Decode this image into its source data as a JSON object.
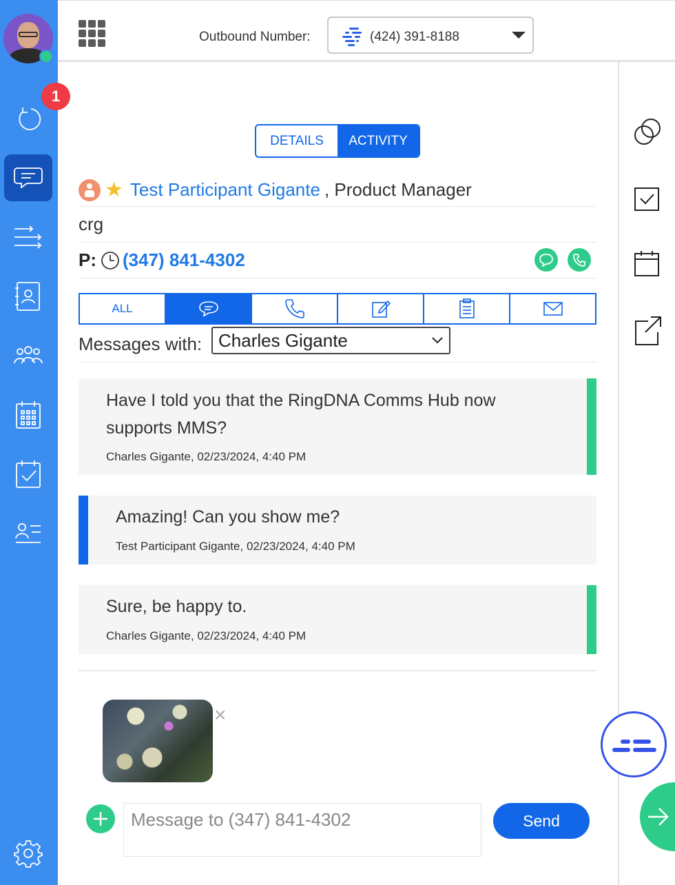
{
  "sidebar": {
    "notification_count": "1",
    "items": [
      {
        "name": "history-icon"
      },
      {
        "name": "messages-icon",
        "active": true
      },
      {
        "name": "cadence-icon"
      },
      {
        "name": "contacts-icon"
      },
      {
        "name": "team-icon"
      },
      {
        "name": "calendar-icon"
      },
      {
        "name": "tasks-icon"
      },
      {
        "name": "list-icon"
      }
    ],
    "settings_icon": "gear-icon"
  },
  "topbar": {
    "outbound_label": "Outbound Number:",
    "outbound_number": "(424) 391-8188"
  },
  "tabs": {
    "details": "DETAILS",
    "activity": "ACTIVITY",
    "active": "activity"
  },
  "contact": {
    "name": "Test Participant Gigante",
    "title": ", Product Manager",
    "account": "crg",
    "phone_prefix": "P:",
    "phone": "(347) 841-4302"
  },
  "filters": {
    "all_label": "ALL",
    "active": "sms"
  },
  "messages_with": {
    "label": "Messages with:",
    "selected": "Charles Gigante"
  },
  "messages": [
    {
      "text": "Have I told you that the RingDNA Comms Hub now supports MMS?",
      "sender": "Charles Gigante",
      "timestamp": "02/23/2024, 4:40 PM",
      "direction": "outbound"
    },
    {
      "text": "Amazing! Can you show me?",
      "sender": "Test Participant Gigante",
      "timestamp": "02/23/2024, 4:40 PM",
      "direction": "inbound"
    },
    {
      "text": "Sure, be happy to.",
      "sender": "Charles Gigante",
      "timestamp": "02/23/2024, 4:40 PM",
      "direction": "outbound"
    }
  ],
  "compose": {
    "placeholder": "Message to (347) 841-4302",
    "send_label": "Send",
    "meta_separator": ","
  },
  "colors": {
    "sidebar": "#3c8df0",
    "primary": "#1267e8",
    "accent_green": "#2ecc8a",
    "badge_red": "#ee3b46"
  }
}
